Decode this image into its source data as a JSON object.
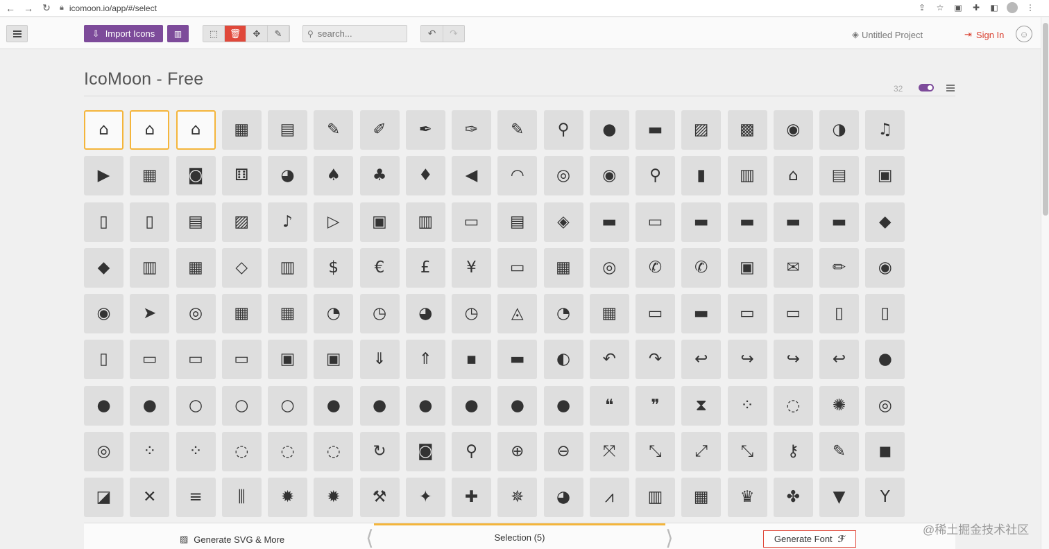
{
  "browser": {
    "url": "icomoon.io/app/#/select"
  },
  "toolbar": {
    "import_label": "Import Icons",
    "search_placeholder": "search...",
    "project_label": "Untitled Project",
    "signin_label": "Sign In"
  },
  "icon_set": {
    "title": "IcoMoon - Free",
    "size": "32"
  },
  "icons": [
    "⌂",
    "⌂",
    "⌂",
    "▦",
    "▤",
    "✎",
    "✐",
    "✒",
    "✑",
    "✎",
    "⚲",
    "●",
    "▬",
    "▨",
    "▩",
    "◉",
    "◑",
    "♫",
    "▶",
    "▦",
    "◙",
    "⚅",
    "◕",
    "♠",
    "♣",
    "♦",
    "◀",
    "◠",
    "◎",
    "◉",
    "⚲",
    "▮",
    "▥",
    "⌂",
    "▤",
    "▣",
    "▯",
    "▯",
    "▤",
    "▨",
    "♪",
    "▷",
    "▣",
    "▥",
    "▭",
    "▤",
    "◈",
    "▬",
    "▭",
    "▬",
    "▬",
    "▬",
    "▬",
    "◆",
    "◆",
    "▥",
    "▦",
    "◇",
    "▥",
    "$",
    "€",
    "£",
    "¥",
    "▭",
    "▦",
    "◎",
    "✆",
    "✆",
    "▣",
    "✉",
    "✏",
    "◉",
    "◉",
    "➤",
    "◎",
    "▦",
    "▦",
    "◔",
    "◷",
    "◕",
    "◷",
    "◬",
    "◔",
    "▦",
    "▭",
    "▬",
    "▭",
    "▭",
    "▯",
    "▯",
    "▯",
    "▭",
    "▭",
    "▭",
    "▣",
    "▣",
    "⇓",
    "⇑",
    "▪",
    "▬",
    "◐",
    "↶",
    "↷",
    "↩",
    "↪",
    "↪",
    "↩",
    "●",
    "●",
    "●",
    "○",
    "○",
    "○",
    "●",
    "●",
    "●",
    "●",
    "●",
    "●",
    "❝",
    "❞",
    "⧗",
    "⁘",
    "◌",
    "✺",
    "◎",
    "◎",
    "⁘",
    "⁘",
    "◌",
    "◌",
    "◌",
    "↻",
    "◙",
    "⚲",
    "⊕",
    "⊖",
    "⤧",
    "⤡",
    "⤢",
    "⤡",
    "⚷",
    "✎",
    "◼",
    "◪",
    "✕",
    "≡",
    "⫼",
    "✹",
    "✹",
    "⚒",
    "✦",
    "✚",
    "✵",
    "◕",
    "⩘",
    "▥",
    "▦",
    "♛",
    "✤",
    "▼",
    "Y"
  ],
  "bottom": {
    "gen_svg_label": "Generate SVG & More",
    "selection_label": "Selection (5)",
    "gen_font_label": "Generate Font",
    "font_glyph": "ℱ"
  },
  "watermark": "@稀土掘金技术社区"
}
